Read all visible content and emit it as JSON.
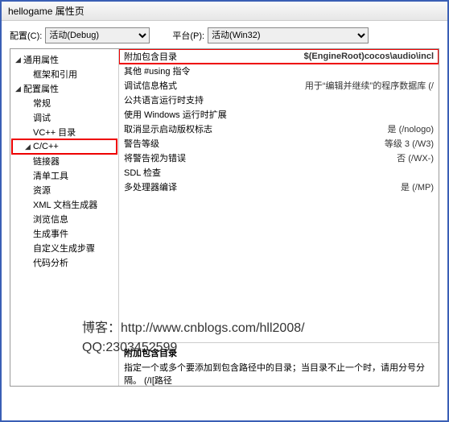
{
  "title": "hellogame 属性页",
  "toprow": {
    "config_label": "配置(C):",
    "config_value": "活动(Debug)",
    "platform_label": "平台(P):",
    "platform_value": "活动(Win32)"
  },
  "tree": [
    {
      "label": "通用属性",
      "depth": 0,
      "expanded": true,
      "children": true,
      "hl": false
    },
    {
      "label": "框架和引用",
      "depth": 1,
      "children": false,
      "hl": false
    },
    {
      "label": "配置属性",
      "depth": 0,
      "expanded": true,
      "children": true,
      "hl": false
    },
    {
      "label": "常规",
      "depth": 1,
      "children": false,
      "hl": false
    },
    {
      "label": "调试",
      "depth": 1,
      "children": false,
      "hl": false
    },
    {
      "label": "VC++ 目录",
      "depth": 1,
      "children": false,
      "hl": false
    },
    {
      "label": "C/C++",
      "depth": 1,
      "expanded": true,
      "children": true,
      "hl": true
    },
    {
      "label": "链接器",
      "depth": 1,
      "children": false,
      "hl": false
    },
    {
      "label": "清单工具",
      "depth": 1,
      "children": false,
      "hl": false
    },
    {
      "label": "资源",
      "depth": 1,
      "children": false,
      "hl": false
    },
    {
      "label": "XML 文档生成器",
      "depth": 1,
      "children": false,
      "hl": false
    },
    {
      "label": "浏览信息",
      "depth": 1,
      "children": false,
      "hl": false
    },
    {
      "label": "生成事件",
      "depth": 1,
      "children": false,
      "hl": false
    },
    {
      "label": "自定义生成步骤",
      "depth": 1,
      "children": false,
      "hl": false
    },
    {
      "label": "代码分析",
      "depth": 1,
      "children": false,
      "hl": false
    }
  ],
  "props": [
    {
      "key": "附加包含目录",
      "value": "$(EngineRoot)cocos\\audio\\incl",
      "hl": true
    },
    {
      "key": "其他 #using 指令",
      "value": "",
      "hl": false
    },
    {
      "key": "调试信息格式",
      "value": "用于“编辑并继续”的程序数据库 (/",
      "hl": false
    },
    {
      "key": "公共语言运行时支持",
      "value": "",
      "hl": false
    },
    {
      "key": "使用 Windows 运行时扩展",
      "value": "",
      "hl": false
    },
    {
      "key": "取消显示启动版权标志",
      "value": "是 (/nologo)",
      "hl": false
    },
    {
      "key": "警告等级",
      "value": "等级 3 (/W3)",
      "hl": false
    },
    {
      "key": "将警告视为错误",
      "value": "否 (/WX-)",
      "hl": false
    },
    {
      "key": "SDL 检查",
      "value": "",
      "hl": false
    },
    {
      "key": "多处理器编译",
      "value": "是 (/MP)",
      "hl": false
    }
  ],
  "desc": {
    "title": "附加包含目录",
    "text": "指定一个或多个要添加到包含路径中的目录；当目录不止一个时，请用分号分隔。      (/I[路径"
  },
  "watermark": {
    "line1": "博客：http://www.cnblogs.com/hll2008/",
    "line2": "QQ:2303452599"
  }
}
